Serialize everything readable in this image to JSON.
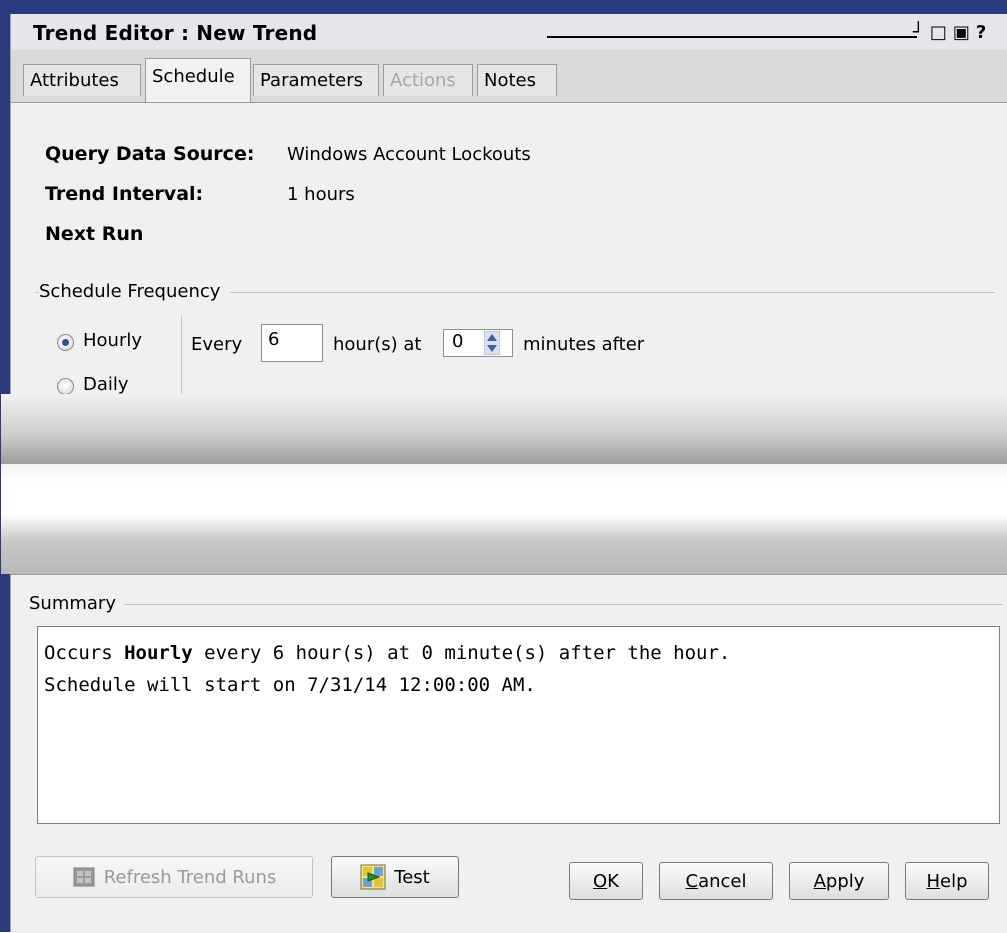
{
  "window": {
    "title": "Trend Editor : New Trend",
    "controls": "┘□▣?"
  },
  "tabs": [
    {
      "label": "Attributes",
      "state": "normal"
    },
    {
      "label": "Schedule",
      "state": "active"
    },
    {
      "label": "Parameters",
      "state": "normal"
    },
    {
      "label": "Actions",
      "state": "disabled"
    },
    {
      "label": "Notes",
      "state": "normal"
    }
  ],
  "info": {
    "query_label": "Query Data Source:",
    "query_value": "Windows Account Lockouts",
    "interval_label": "Trend Interval:",
    "interval_value": "1 hours",
    "next_run_label": "Next Run"
  },
  "schedule": {
    "group_title": "Schedule Frequency",
    "hourly_label": "Hourly",
    "daily_label": "Daily",
    "selected": "Hourly",
    "every_label": "Every",
    "hours_value": "6",
    "hours_suffix": "hour(s) at",
    "minutes_value": "0",
    "minutes_suffix": "minutes after"
  },
  "summary": {
    "group_title": "Summary",
    "line1_prefix": "Occurs ",
    "line1_bold": "Hourly",
    "line1_rest": " every 6 hour(s) at 0 minute(s) after the hour.",
    "line2": "Schedule will start on 7/31/14 12:00:00 AM."
  },
  "buttons": {
    "refresh": "Refresh Trend Runs",
    "test": "Test",
    "ok_mn": "O",
    "ok_rest": "K",
    "cancel_mn": "C",
    "cancel_rest": "ancel",
    "apply_mn": "A",
    "apply_rest": "pply",
    "help_mn": "H",
    "help_rest": "elp"
  },
  "colors": {
    "window_frame": "#2a3a7c",
    "radio_selected": "#2b4f9c"
  }
}
